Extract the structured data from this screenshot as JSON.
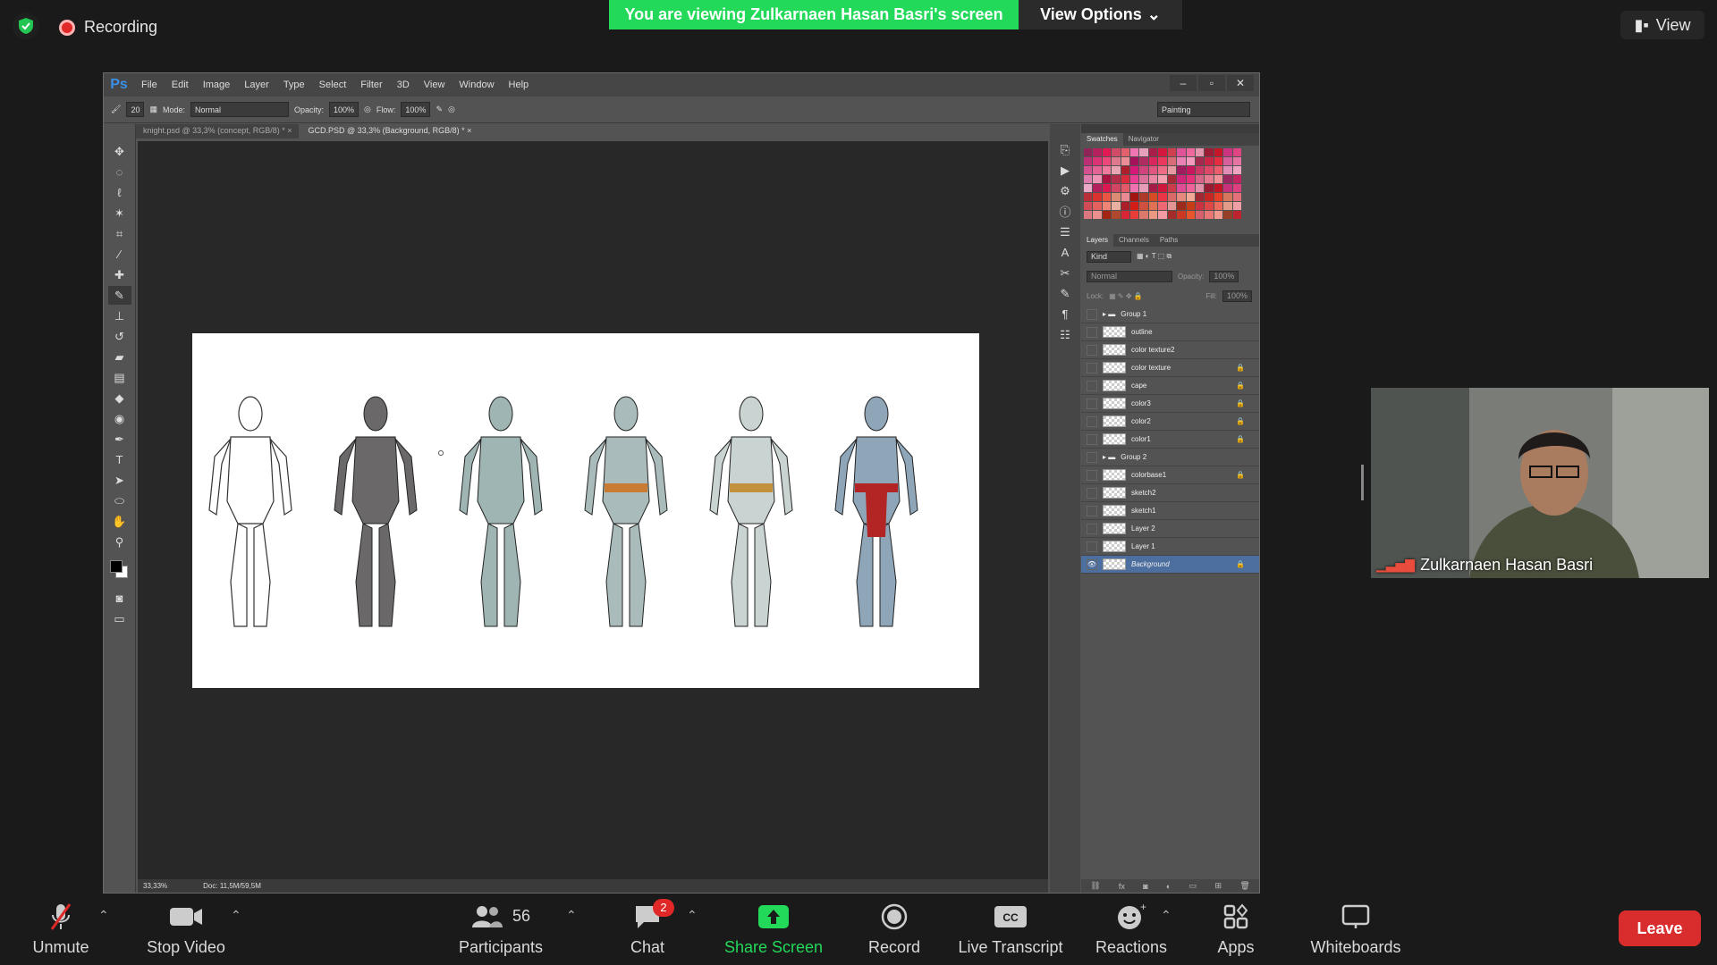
{
  "zoom": {
    "recording_label": "Recording",
    "viewing_banner": "You are viewing Zulkarnaen Hasan Basri's screen",
    "view_options": "View Options",
    "view_top": "View",
    "presenter_name": "Zulkarnaen Hasan Basri",
    "participants_count": "56",
    "chat_badge": "2",
    "buttons": {
      "unmute": "Unmute",
      "stop_video": "Stop Video",
      "participants": "Participants",
      "chat": "Chat",
      "share_screen": "Share Screen",
      "record": "Record",
      "live_transcript": "Live Transcript",
      "reactions": "Reactions",
      "apps": "Apps",
      "whiteboards": "Whiteboards",
      "leave": "Leave"
    },
    "colors": {
      "share_green": "#23d959",
      "leave_red": "#d92c2c"
    }
  },
  "photoshop": {
    "logo": "Ps",
    "menu": [
      "File",
      "Edit",
      "Image",
      "Layer",
      "Type",
      "Select",
      "Filter",
      "3D",
      "View",
      "Window",
      "Help"
    ],
    "options": {
      "brush_size": "20",
      "mode_label": "Mode:",
      "mode_value": "Normal",
      "opacity_label": "Opacity:",
      "opacity_value": "100%",
      "flow_label": "Flow:",
      "flow_value": "100%",
      "workspace": "Painting"
    },
    "tabs": [
      {
        "label": "knight.psd @ 33,3% (concept, RGB/8) *",
        "active": false
      },
      {
        "label": "GCD.PSD @ 33,3% (Background, RGB/8) *",
        "active": true
      }
    ],
    "status": {
      "zoom": "33,33%",
      "doc": "Doc: 11,5M/59,5M"
    },
    "panels": {
      "swatch_tabs": [
        "Swatches",
        "Navigator"
      ],
      "layer_tabs": [
        "Layers",
        "Channels",
        "Paths"
      ],
      "kind_label": "Kind",
      "blend_mode": "Normal",
      "opacity_label": "Opacity:",
      "opacity_value": "100%",
      "lock_label": "Lock:",
      "fill_label": "Fill:",
      "fill_value": "100%"
    },
    "layers": [
      {
        "name": "Group 1",
        "group": true,
        "locked": false,
        "visible": false
      },
      {
        "name": "outline",
        "group": false,
        "locked": false,
        "visible": false
      },
      {
        "name": "color texture2",
        "group": false,
        "locked": false,
        "visible": false
      },
      {
        "name": "color texture",
        "group": false,
        "locked": true,
        "visible": false
      },
      {
        "name": "cape",
        "group": false,
        "locked": true,
        "visible": false
      },
      {
        "name": "color3",
        "group": false,
        "locked": true,
        "visible": false
      },
      {
        "name": "color2",
        "group": false,
        "locked": true,
        "visible": false
      },
      {
        "name": "color1",
        "group": false,
        "locked": true,
        "visible": false
      },
      {
        "name": "Group 2",
        "group": true,
        "locked": false,
        "visible": false
      },
      {
        "name": "colorbase1",
        "group": false,
        "locked": true,
        "visible": false
      },
      {
        "name": "sketch2",
        "group": false,
        "locked": false,
        "visible": false
      },
      {
        "name": "sketch1",
        "group": false,
        "locked": false,
        "visible": false
      },
      {
        "name": "Layer 2",
        "group": false,
        "locked": false,
        "visible": false
      },
      {
        "name": "Layer 1",
        "group": false,
        "locked": false,
        "visible": false
      },
      {
        "name": "Background",
        "group": false,
        "locked": true,
        "visible": true,
        "selected": true
      }
    ],
    "figures": [
      {
        "stage": "line sketch",
        "fill": "#ffffff",
        "accent": "#ffffff"
      },
      {
        "stage": "silhouette",
        "fill": "#6a6868",
        "accent": "#6a6868"
      },
      {
        "stage": "base armor",
        "fill": "#9fb5b3",
        "accent": "#9fb5b3"
      },
      {
        "stage": "color blocking",
        "fill": "#a9bcbb",
        "accent": "#c97a33"
      },
      {
        "stage": "details",
        "fill": "#c9d3d2",
        "accent": "#c2913e"
      },
      {
        "stage": "final color",
        "fill": "#8fa5b8",
        "accent": "#b32424"
      }
    ]
  }
}
